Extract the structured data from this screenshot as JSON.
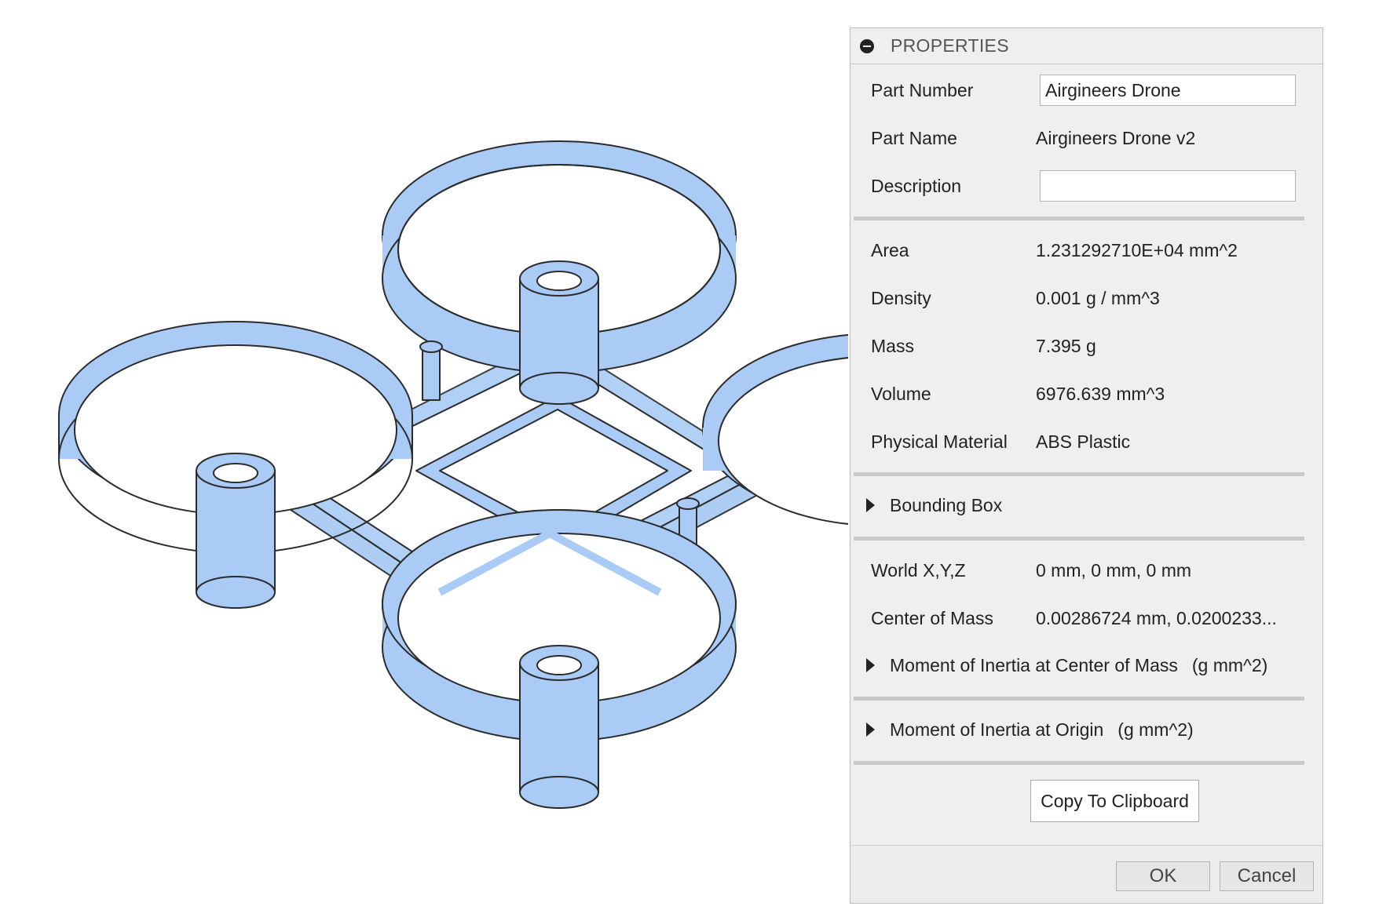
{
  "panel": {
    "title": "PROPERTIES",
    "icon": "collapse-icon"
  },
  "identity": {
    "part_number_label": "Part Number",
    "part_number_value": "Airgineers Drone",
    "part_name_label": "Part Name",
    "part_name_value": "Airgineers Drone v2",
    "description_label": "Description",
    "description_value": ""
  },
  "physical": {
    "area_label": "Area",
    "area_value": "1.231292710E+04 mm^2",
    "density_label": "Density",
    "density_value": "0.001 g / mm^3",
    "mass_label": "Mass",
    "mass_value": "7.395 g",
    "volume_label": "Volume",
    "volume_value": "6976.639 mm^3",
    "material_label": "Physical Material",
    "material_value": "ABS Plastic"
  },
  "bounding_box": {
    "label": "Bounding Box",
    "expanded": false
  },
  "coords": {
    "world_label": "World X,Y,Z",
    "world_value": "0 mm, 0 mm, 0 mm",
    "com_label": "Center of Mass",
    "com_value": "0.00286724 mm, 0.0200233..."
  },
  "inertia_com": {
    "label": "Moment of Inertia at Center of Mass",
    "unit": "(g mm^2)"
  },
  "inertia_origin": {
    "label": "Moment of Inertia at Origin",
    "unit": "(g mm^2)"
  },
  "actions": {
    "copy_label": "Copy To Clipboard",
    "ok_label": "OK",
    "cancel_label": "Cancel"
  },
  "colors": {
    "model_fill": "#a9cbf5",
    "model_outline": "#2b2b2b",
    "panel_bg": "#efefef"
  }
}
